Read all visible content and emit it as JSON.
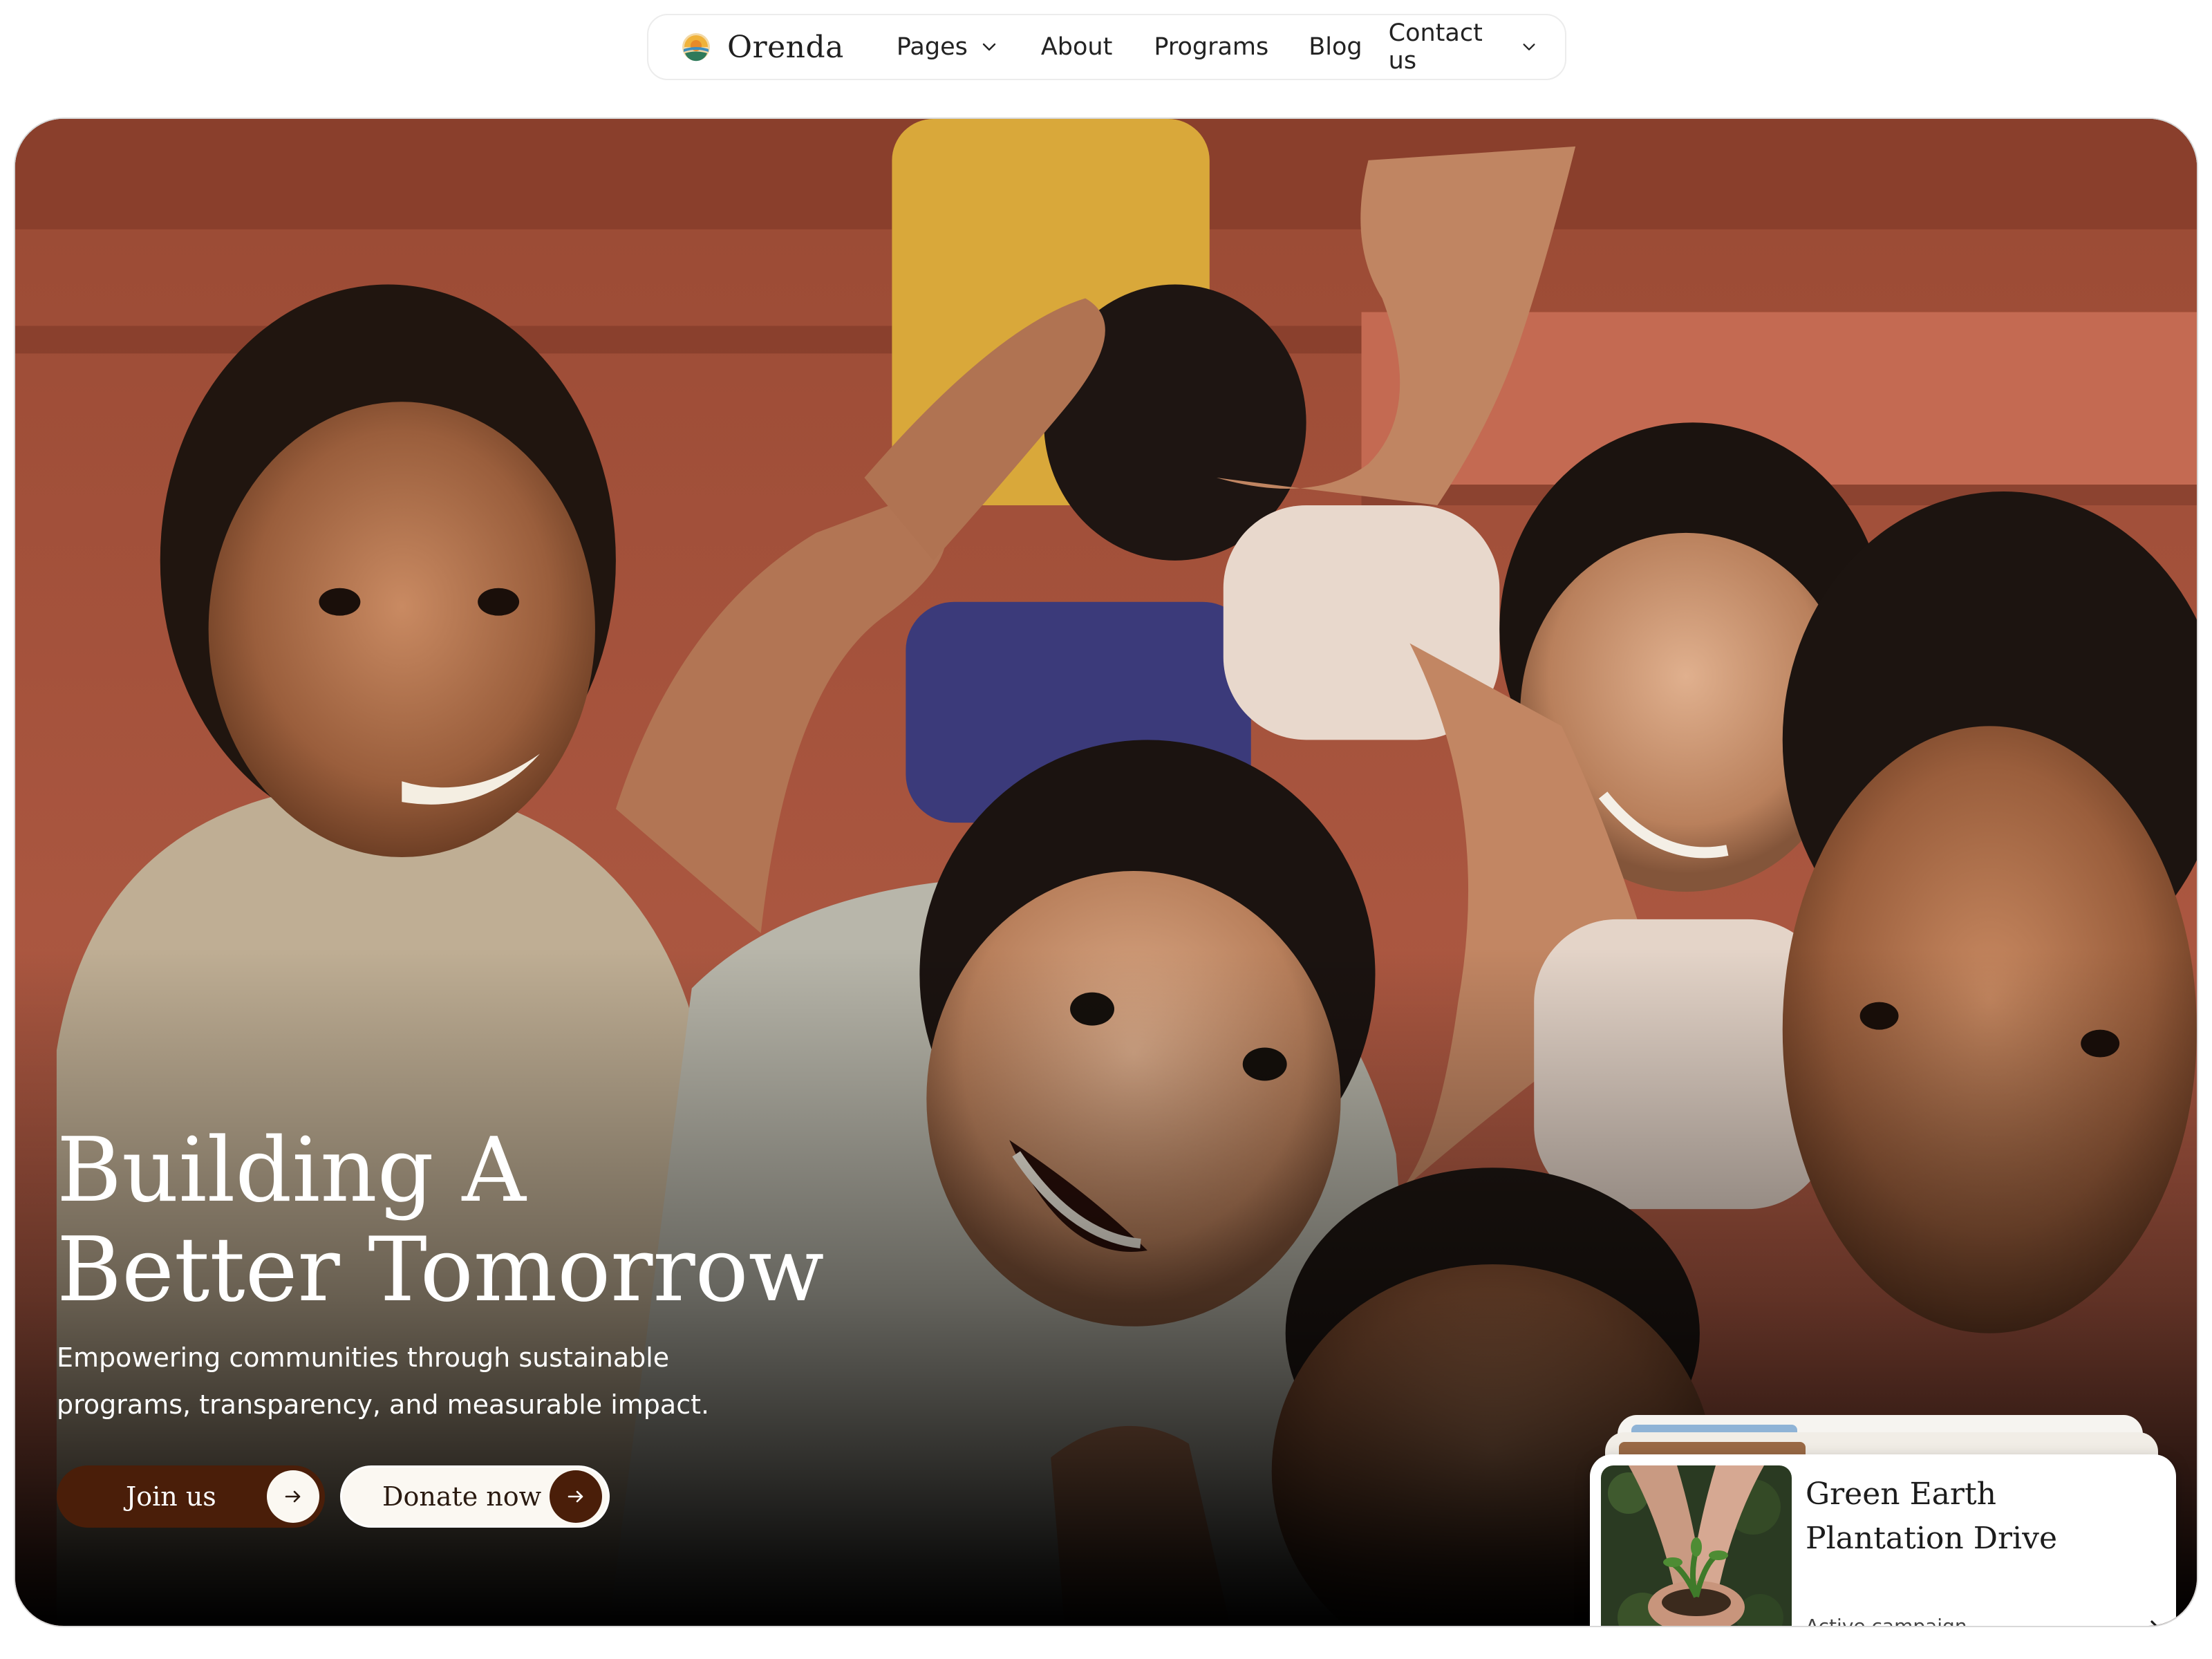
{
  "nav": {
    "brand": "Orenda",
    "items": [
      {
        "label": "Pages",
        "has_dropdown": true
      },
      {
        "label": "About",
        "has_dropdown": false
      },
      {
        "label": "Programs",
        "has_dropdown": false
      },
      {
        "label": "Blog",
        "has_dropdown": false
      },
      {
        "label": "Contact us",
        "has_dropdown": true
      }
    ]
  },
  "hero": {
    "title_line1": "Building A",
    "title_line2": "Better Tomorrow",
    "subtitle": "Empowering communities through sustainable programs, transparency, and measurable impact.",
    "primary_button": "Join us",
    "secondary_button": "Donate now",
    "image": "smiling-children-photo"
  },
  "campaign_card": {
    "title": "Green Earth Plantation Drive",
    "status": "Active campaign",
    "image": "hands-holding-seedling-photo"
  },
  "icons": {
    "logo": "sun-logo-icon",
    "dropdown": "chevron-down-icon",
    "arrow": "arrow-right-icon"
  },
  "colors": {
    "accent_brown": "#4a1e09",
    "cream": "#fbf8f2",
    "text_dark": "#222222"
  }
}
